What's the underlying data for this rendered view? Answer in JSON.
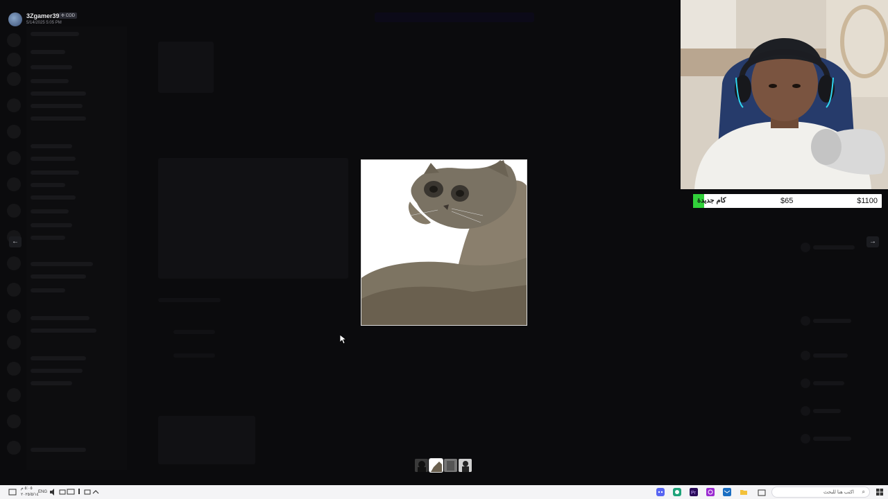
{
  "viewer": {
    "uploader_name": "3Zgamer390",
    "uploader_tag": "✣ COD",
    "upload_date": "5/14/2025 5:05 PM",
    "prev_icon": "arrow-left-icon",
    "next_icon": "arrow-right-icon",
    "prev_glyph": "←",
    "next_glyph": "→",
    "thumbnails": [
      "thumb-silhouette",
      "thumb-cat",
      "thumb-grey",
      "thumb-person"
    ]
  },
  "stream_overlay": {
    "donation_title": "كام جديدة",
    "donation_current": "$65",
    "donation_goal": "$1100",
    "donation_progress": 0.059,
    "progress_color": "#32d13a"
  },
  "taskbar": {
    "clock_time": "٥:٠٥ م",
    "clock_date": "٢٠٢٥/٥/١٤",
    "language": "ENG",
    "search_placeholder": "اكتب هنا للبحث",
    "search_icon": "search-icon",
    "start_icon": "windows-start-icon",
    "pinned_apps": [
      "discord-icon",
      "browser-icon",
      "premiere-icon",
      "obs-icon",
      "mail-icon",
      "folder-icon",
      "store-icon"
    ]
  }
}
